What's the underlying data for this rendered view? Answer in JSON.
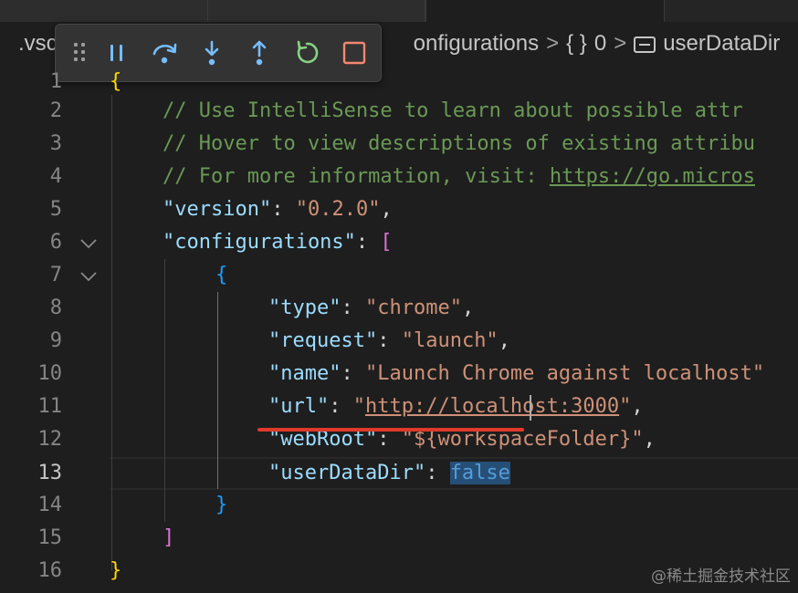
{
  "breadcrumb": {
    "folder": ".vsc",
    "configurations": "onfigurations",
    "object_icon": "{ }",
    "index": "0",
    "property_icon": "property-icon",
    "property": "userDataDir",
    "separator": ">"
  },
  "debug_toolbar": {
    "buttons": [
      "drag-handle",
      "pause",
      "step-over",
      "step-into",
      "step-out",
      "restart",
      "stop"
    ],
    "colors": {
      "default": "#75beff",
      "restart": "#89d185",
      "stop": "#f48771"
    }
  },
  "editor": {
    "active_line": 13,
    "lines": [
      {
        "n": "1"
      },
      {
        "n": "2",
        "comment": "// Use IntelliSense to learn about possible attr"
      },
      {
        "n": "3",
        "comment": "// Hover to view descriptions of existing attribu"
      },
      {
        "n": "4",
        "comment_prefix": "// For more information, visit: ",
        "comment_link": "https://go.micros"
      },
      {
        "n": "5",
        "key": "\"version\"",
        "colon": ": ",
        "value": "\"0.2.0\"",
        "tail": ","
      },
      {
        "n": "6",
        "key": "\"configurations\"",
        "colon": ": ",
        "bracket": "["
      },
      {
        "n": "7",
        "brace": "{"
      },
      {
        "n": "8",
        "key": "\"type\"",
        "colon": ": ",
        "value": "\"chrome\"",
        "tail": ","
      },
      {
        "n": "9",
        "key": "\"request\"",
        "colon": ": ",
        "value": "\"launch\"",
        "tail": ","
      },
      {
        "n": "10",
        "key": "\"name\"",
        "colon": ": ",
        "value": "\"Launch Chrome against localhost\""
      },
      {
        "n": "11",
        "key": "\"url\"",
        "colon": ": ",
        "value_q1": "\"",
        "value_link": "http://localhost:3000",
        "value_q2": "\"",
        "tail": ","
      },
      {
        "n": "12",
        "key": "\"webRoot\"",
        "colon": ": ",
        "value": "\"${workspaceFolder}\"",
        "tail": ","
      },
      {
        "n": "13",
        "key": "\"userDataDir\"",
        "colon": ": ",
        "value": "false"
      },
      {
        "n": "14",
        "brace": "}"
      },
      {
        "n": "15",
        "bracket": "]"
      },
      {
        "n": "16",
        "brace": "}"
      }
    ]
  },
  "watermark": "@稀土掘金技术社区"
}
